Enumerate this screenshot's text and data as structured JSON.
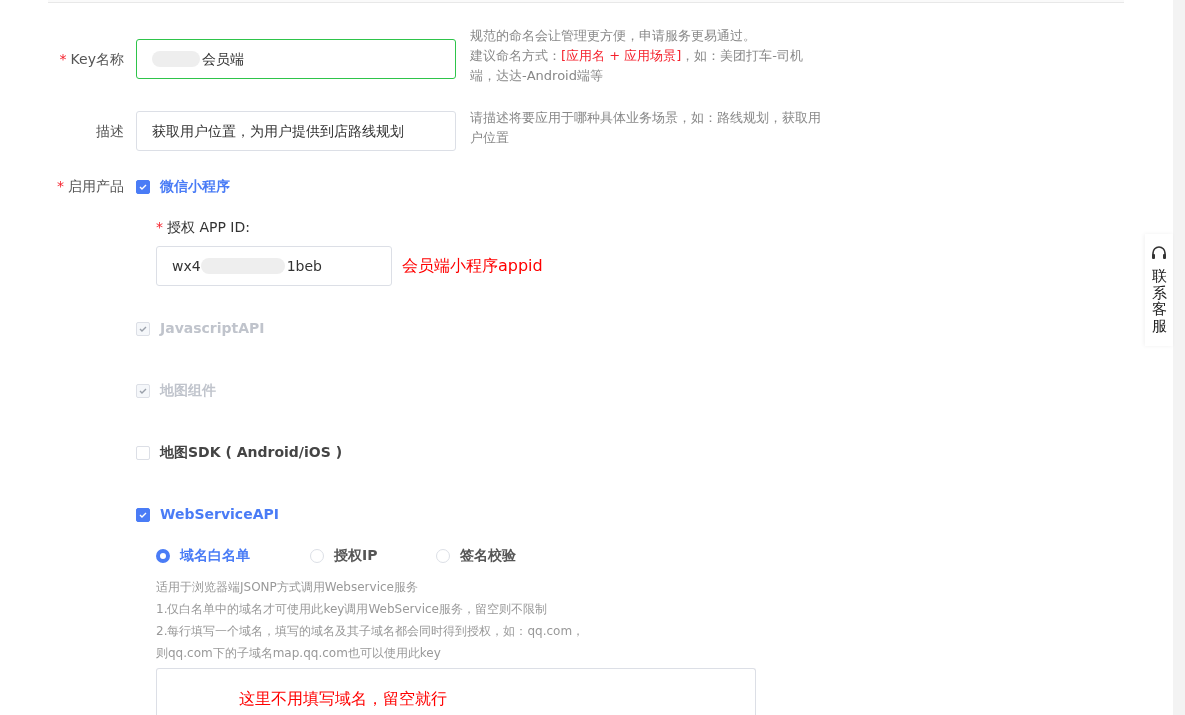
{
  "fields": [
    {
      "label": "Key名称",
      "required_mark": "*",
      "kind": "text",
      "value": "会员端",
      "blurred_prefix": true,
      "focused": true,
      "help": [
        "规范的命名会让管理更方便，申请服务更易通过。",
        "建议命名方式：**[应用名 + 应用场景]**，如：美团打车-司机端，达达-Android端等"
      ]
    },
    {
      "label": "描述",
      "kind": "text",
      "value": "获取用户位置，为用户提供到店路线规划",
      "focused": false,
      "help": [
        "请描述将要应用于哪种具体业务场景，如：路线规划，获取用户位置"
      ]
    }
  ],
  "products": {
    "label": "启用产品",
    "required_mark": "*",
    "items": [
      {
        "label": "微信小程序",
        "checked": true,
        "disabled": false,
        "kind": "appid",
        "appid": {
          "label": "授权 APP ID:",
          "required_mark": "*",
          "value_start": "wx4",
          "value_end": "1beb",
          "annotation": "会员端小程序appid"
        }
      },
      {
        "label": "JavascriptAPI",
        "checked": true,
        "disabled": true,
        "kind": "plain"
      },
      {
        "label": "地图组件",
        "checked": true,
        "disabled": true,
        "kind": "plain"
      },
      {
        "label": "地图SDK ( Android/iOS )",
        "checked": false,
        "kind": "plain"
      },
      {
        "label": "WebServiceAPI",
        "checked": true,
        "disabled": false,
        "kind": "webservice",
        "options": [
          {
            "label": "域名白名单",
            "selected": true
          },
          {
            "label": "授权IP",
            "selected": false
          },
          {
            "label": "签名校验",
            "selected": false
          }
        ],
        "notes": [
          "适用于浏览器端JSONP方式调用Webservice服务",
          "1.仅白名单中的域名才可使用此key调用WebService服务，留空则不限制",
          "2.每行填写一个域名，填写的域名及其子域名都会同时得到授权，如：qq.com，则qq.com下的子域名map.qq.com也可以使用此key"
        ],
        "annotation": "这里不用填写域名，留空就行"
      }
    ]
  },
  "side_tab": {
    "label": "联系客服"
  }
}
